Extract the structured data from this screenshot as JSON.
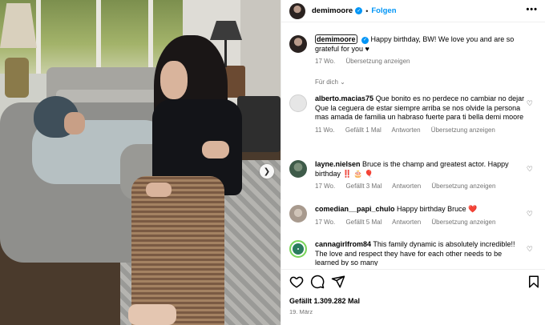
{
  "header": {
    "username": "demimoore",
    "separator": "•",
    "follow_label": "Folgen",
    "more_label": "•••"
  },
  "caption": {
    "username": "demimoore",
    "text": "Happy birthday, BW! We love you and are so grateful for you ♥",
    "age": "17 Wo.",
    "translate": "Übersetzung anzeigen"
  },
  "see_for_you": "Für dich",
  "comments": [
    {
      "username": "alberto.macias75",
      "text": "Que bonito es no perdece no cambiar no dejar Que la ceguera de estar siempre arriba se nos olvide la persona mas amada de familia un habraso fuerte para ti bella demi moore",
      "age": "11 Wo.",
      "likes": "Gefällt 1 Mal",
      "reply": "Antworten",
      "translate": "Übersetzung anzeigen"
    },
    {
      "username": "layne.nielsen",
      "text": "Bruce is the champ and greatest actor. Happy birthday ‼️ 🎂 🎈",
      "age": "17 Wo.",
      "likes": "Gefällt 3 Mal",
      "reply": "Antworten",
      "translate": "Übersetzung anzeigen"
    },
    {
      "username": "comedian__papi_chulo",
      "text": "Happy birthday Bruce ❤️",
      "age": "17 Wo.",
      "likes": "Gefällt 5 Mal",
      "reply": "Antworten",
      "translate": "Übersetzung anzeigen"
    },
    {
      "username": "cannagirlfrom84",
      "text": "This family dynamic is absolutely incredible!! The love and respect they have for each other needs to be learned by so many"
    }
  ],
  "footer": {
    "likes": "Gefällt 1.309.282 Mal",
    "date": "19. März"
  },
  "icons": {
    "like": "heart-outline-icon",
    "comment": "comment-bubble-icon",
    "share": "paper-plane-icon",
    "save": "bookmark-icon",
    "next": "chevron-right-icon"
  },
  "colors": {
    "accent": "#0095f6",
    "muted": "#737373",
    "heart_red": "#ed4956"
  }
}
